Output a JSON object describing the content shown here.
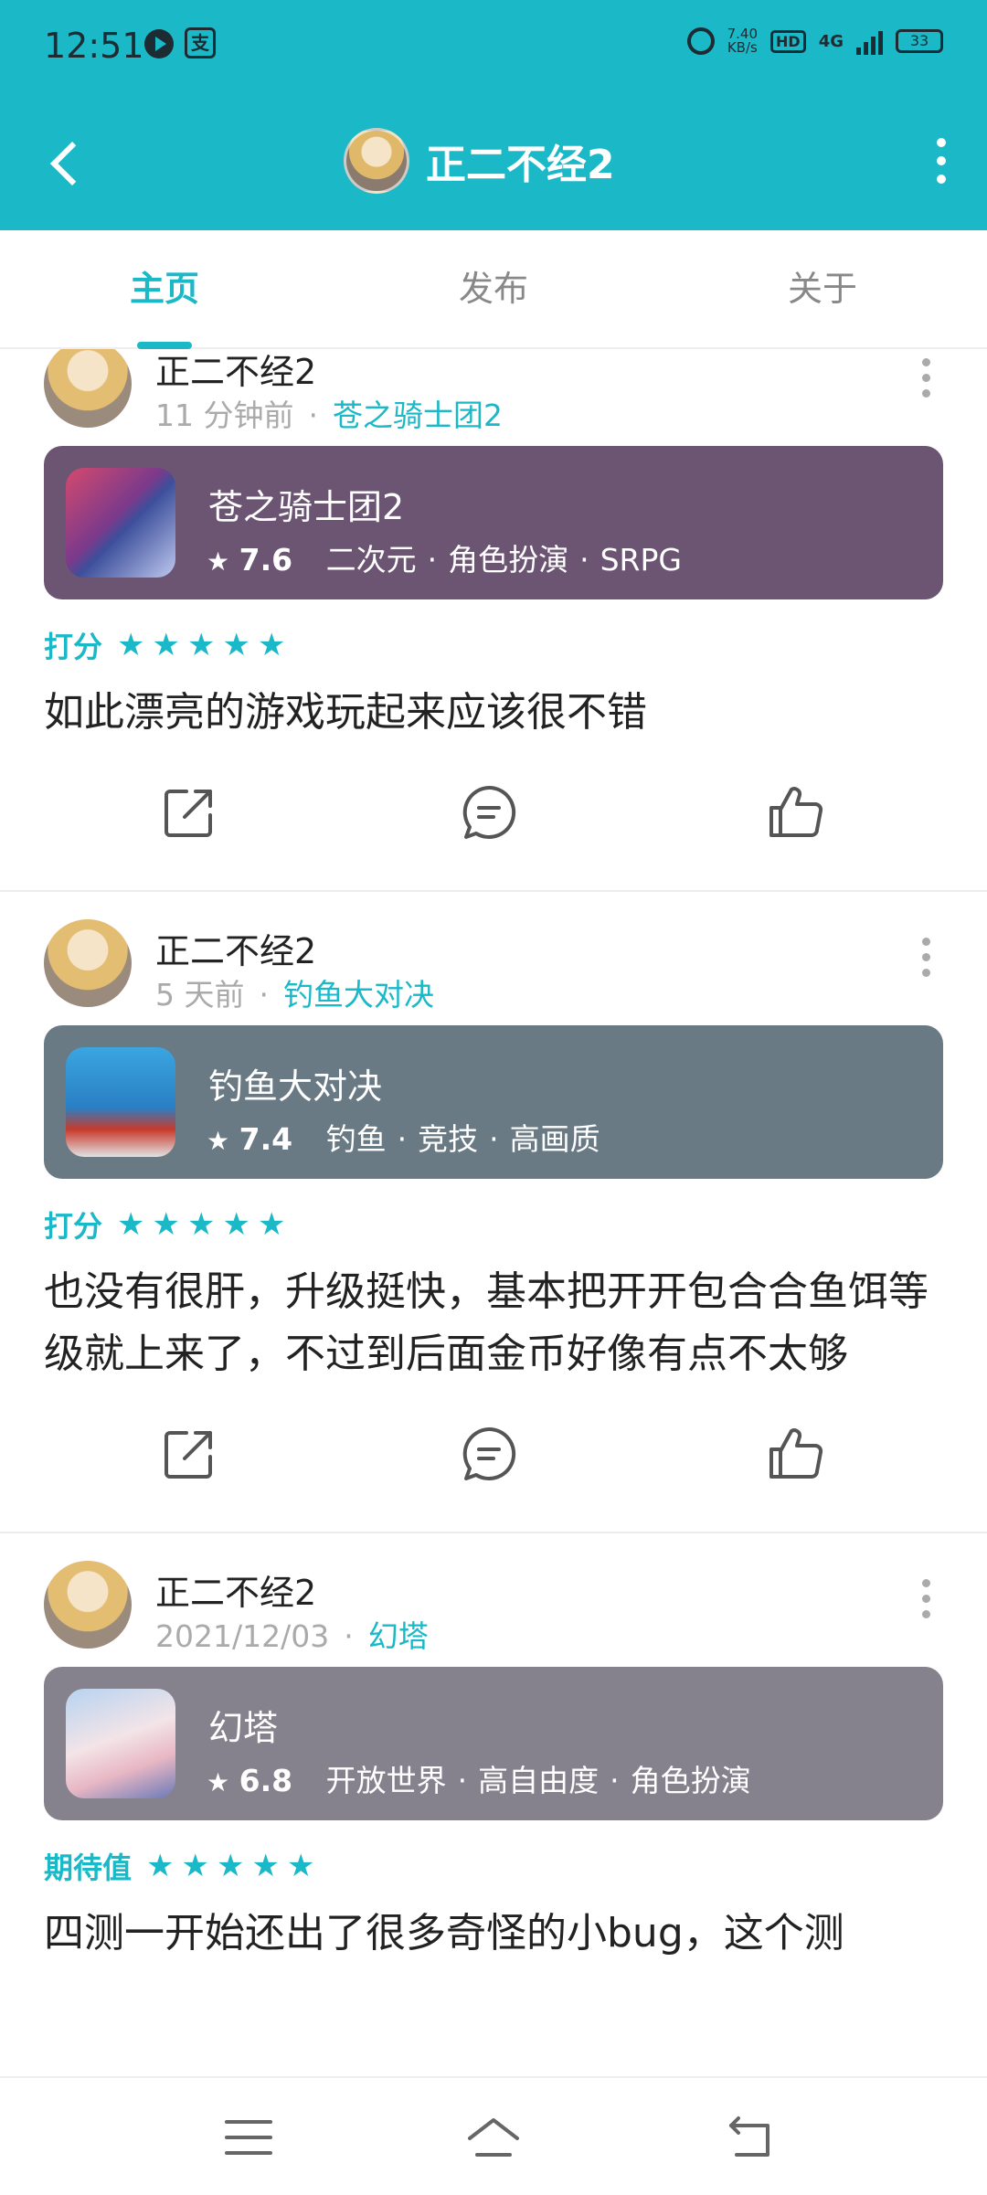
{
  "status_bar": {
    "time": "12:51",
    "app_icon_2": "支",
    "net_speed_value": "7.40",
    "net_speed_unit": "KB/s",
    "hd": "HD",
    "network": "4G",
    "battery": "33"
  },
  "header": {
    "title": "正二不经2",
    "accent_color": "#1bb9c8"
  },
  "tabs": [
    {
      "label": "主页",
      "active": true
    },
    {
      "label": "发布",
      "active": false
    },
    {
      "label": "关于",
      "active": false
    }
  ],
  "posts": [
    {
      "author": "正二不经2",
      "time": "11 分钟前",
      "game_link": "苍之骑士团2",
      "game": {
        "name": "苍之骑士团2",
        "score": "7.6",
        "tags": [
          "二次元",
          "角色扮演",
          "SRPG"
        ],
        "card_color": "#6c5573"
      },
      "rating_label": "打分",
      "stars": "★★★★★",
      "review": "如此漂亮的游戏玩起来应该很不错"
    },
    {
      "author": "正二不经2",
      "time": "5 天前",
      "game_link": "钓鱼大对决",
      "game": {
        "name": "钓鱼大对决",
        "score": "7.4",
        "tags": [
          "钓鱼",
          "竞技",
          "高画质"
        ],
        "card_color": "#697a84"
      },
      "rating_label": "打分",
      "stars": "★★★★★",
      "review": "也没有很肝，升级挺快，基本把开开包合合鱼饵等级就上来了，不过到后面金币好像有点不太够"
    },
    {
      "author": "正二不经2",
      "time": "2021/12/03",
      "game_link": "幻塔",
      "game": {
        "name": "幻塔",
        "score": "6.8",
        "tags": [
          "开放世界",
          "高自由度",
          "角色扮演"
        ],
        "card_color": "#86828d"
      },
      "rating_label": "期待值",
      "stars": "★★★★★",
      "review": "四测一开始还出了很多奇怪的小bug，这个测"
    }
  ]
}
